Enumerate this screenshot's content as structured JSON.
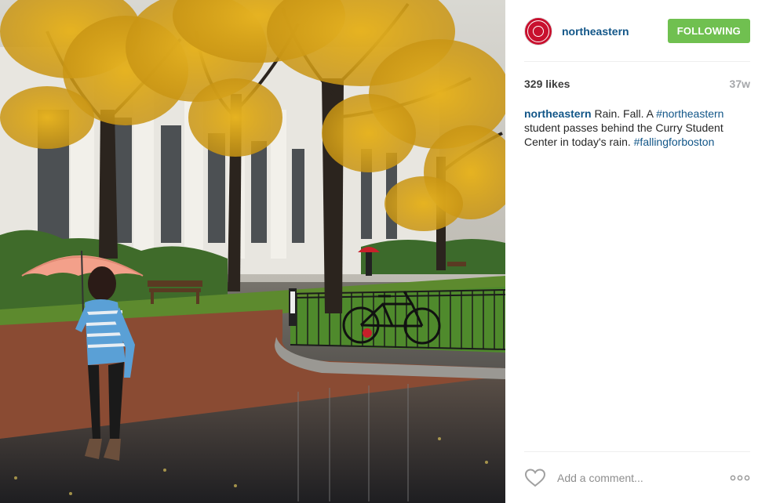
{
  "post": {
    "username": "northeastern",
    "follow_label": "FOLLOWING",
    "likes": "329 likes",
    "time_ago": "37w",
    "caption": {
      "username": "northeastern",
      "text1": " Rain. Fall. A ",
      "hashtag1": "#northeastern",
      "text2": " student passes behind the Curry Student Center in today's rain. ",
      "hashtag2": "#fallingforboston"
    },
    "comment_placeholder": "Add a comment..."
  },
  "icons": {
    "avatar": "northeastern-seal-icon",
    "like": "heart-icon",
    "more": "ellipsis-icon"
  },
  "colors": {
    "follow_button": "#70c050",
    "link": "#125688",
    "brand_red": "#c8102e"
  }
}
